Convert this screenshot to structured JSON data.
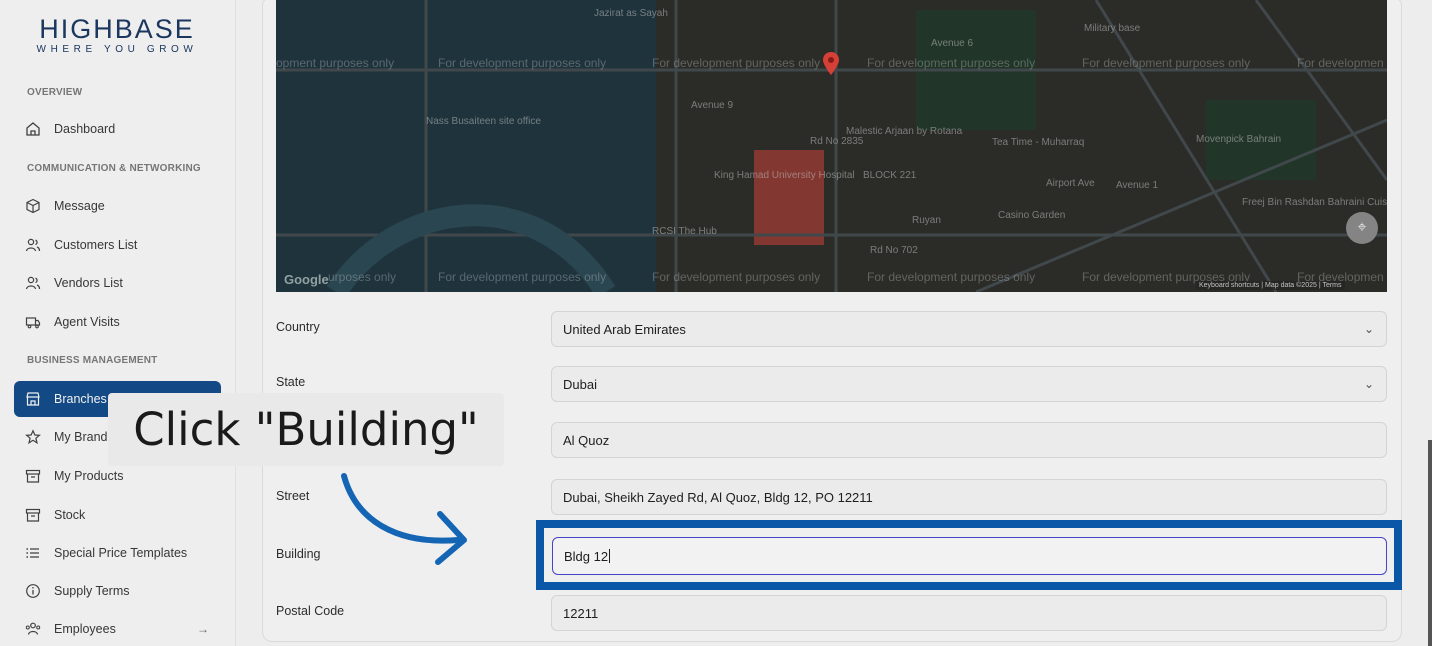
{
  "brand": {
    "name": "HIGHBASE",
    "tagline": "WHERE YOU GROW"
  },
  "sidebar": {
    "sections": [
      {
        "label": "OVERVIEW"
      },
      {
        "label": "COMMUNICATION & NETWORKING"
      },
      {
        "label": "BUSINESS MANAGEMENT"
      }
    ],
    "items": [
      {
        "label": "Dashboard",
        "icon": "home-icon"
      },
      {
        "label": "Message",
        "icon": "box-icon"
      },
      {
        "label": "Customers List",
        "icon": "users-icon"
      },
      {
        "label": "Vendors List",
        "icon": "users-icon"
      },
      {
        "label": "Agent Visits",
        "icon": "truck-icon"
      },
      {
        "label": "Branches",
        "icon": "store-icon",
        "active": true
      },
      {
        "label": "My Brand",
        "icon": "star-icon"
      },
      {
        "label": "My Products",
        "icon": "archive-icon"
      },
      {
        "label": "Stock",
        "icon": "archive-icon"
      },
      {
        "label": "Special Price Templates",
        "icon": "list-icon"
      },
      {
        "label": "Supply Terms",
        "icon": "info-icon"
      },
      {
        "label": "Employees",
        "icon": "people-icon",
        "arrow": "→"
      }
    ]
  },
  "map": {
    "watermark": "For development purposes only",
    "watermark_cut": "opment purposes only",
    "watermark_cut2": "urposes only",
    "watermark_cut3": "For developmen",
    "pois": [
      "Jazirat as Sayah",
      "Nass Busaiteen site office",
      "Avenue 9",
      "Avenue 6",
      "Malestic Arjaan by Rotana",
      "King Hamad University Hospital",
      "BLOCK 221",
      "RCSI The Hub",
      "Tea Time - Muharraq",
      "Movenpick Bahrain",
      "Casino Garden",
      "Ruyan",
      "Freej Bin Rashdan Bahraini Cuisine",
      "Rd No 702",
      "Avenue 1",
      "Airport Ave",
      "Rd No 2835",
      "Military base"
    ],
    "google_logo": "Google",
    "footer": "Keyboard shortcuts | Map data ©2025 | Terms"
  },
  "form": {
    "country": {
      "label": "Country",
      "value": "United Arab Emirates"
    },
    "state": {
      "label": "State",
      "value": "Dubai"
    },
    "area": {
      "value": "Al Quoz"
    },
    "street": {
      "label": "Street",
      "value": "Dubai, Sheikh Zayed Rd, Al Quoz, Bldg 12, PO 12211"
    },
    "building": {
      "label": "Building",
      "value": "Bldg 12"
    },
    "postal": {
      "label": "Postal Code",
      "value": "12211"
    }
  },
  "tutorial": {
    "instruction": "Click \"Building\"",
    "highlight_color": "#0b5bb0"
  },
  "colors": {
    "active": "#154d8c",
    "brand": "#1d3a66",
    "focus": "#4b48d6"
  }
}
